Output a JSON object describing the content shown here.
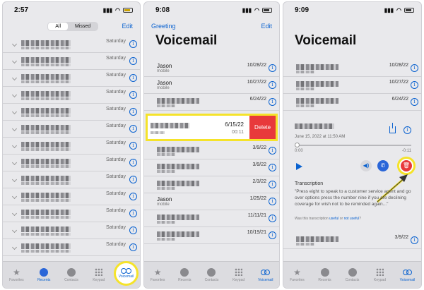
{
  "panel1": {
    "time": "2:57",
    "battery": "64",
    "segments": [
      "All",
      "Missed"
    ],
    "edit": "Edit",
    "rows": [
      {
        "date": "Saturday"
      },
      {
        "date": "Saturday"
      },
      {
        "date": "Saturday"
      },
      {
        "date": "Saturday"
      },
      {
        "date": "Saturday"
      },
      {
        "date": "Saturday"
      },
      {
        "date": "Saturday"
      },
      {
        "date": "Saturday"
      },
      {
        "date": "Saturday"
      },
      {
        "date": "Saturday"
      },
      {
        "date": "Saturday"
      },
      {
        "date": "Saturday"
      },
      {
        "date": "Saturday"
      }
    ],
    "tabs": [
      "Favorites",
      "Recents",
      "Contacts",
      "Keypad",
      "Voicemail"
    ]
  },
  "panel2": {
    "time": "9:08",
    "greeting": "Greeting",
    "edit": "Edit",
    "title": "Voicemail",
    "rows_top": [
      {
        "name": "Jason",
        "sub": "mobile",
        "date": "10/28/22"
      },
      {
        "name": "Jason",
        "sub": "mobile",
        "date": "10/27/22"
      },
      {
        "name": "",
        "sub": "",
        "date": "6/24/22"
      }
    ],
    "swipe": {
      "date": "6/15/22",
      "duration": "00:11",
      "delete": "Delete"
    },
    "rows_bottom": [
      {
        "name": "",
        "sub": "",
        "date": "3/9/22"
      },
      {
        "name": "",
        "sub": "",
        "date": "3/9/22"
      },
      {
        "name": "",
        "sub": "",
        "date": "2/3/22"
      },
      {
        "name": "Jason",
        "sub": "mobile",
        "date": "1/25/22"
      },
      {
        "name": "",
        "sub": "",
        "date": "11/11/21"
      },
      {
        "name": "",
        "sub": "",
        "date": "10/19/21"
      }
    ],
    "tabs": [
      "Favorites",
      "Recents",
      "Contacts",
      "Keypad",
      "Voicemail"
    ]
  },
  "panel3": {
    "time": "9:09",
    "title": "Voicemail",
    "rows_top": [
      {
        "name": "",
        "sub": "",
        "date": "10/28/22"
      },
      {
        "name": "",
        "sub": "",
        "date": "10/27/22"
      },
      {
        "name": "",
        "sub": "",
        "date": "6/24/22"
      }
    ],
    "detail": {
      "meta": "June 15, 2022 at 11:50 AM",
      "time_start": "0:00",
      "time_end": "-0:11",
      "transcription_title": "Transcription",
      "transcription": "\"Press eight to speak to a customer service agent and go over options press the number nine if you are declining coverage for wish not to be reminded again...\"",
      "feedback_prefix": "Was this transcription",
      "useful": "useful",
      "or": "or",
      "not_useful": "not useful",
      "feedback_suffix": "?"
    },
    "rows_bottom": [
      {
        "name": "",
        "sub": "",
        "date": "3/9/22"
      }
    ],
    "tabs": [
      "Favorites",
      "Recents",
      "Contacts",
      "Keypad",
      "Voicemail"
    ]
  },
  "colors": {
    "accent": "#0a62d0",
    "delete": "#e8393b",
    "highlight": "#f5e32a"
  }
}
